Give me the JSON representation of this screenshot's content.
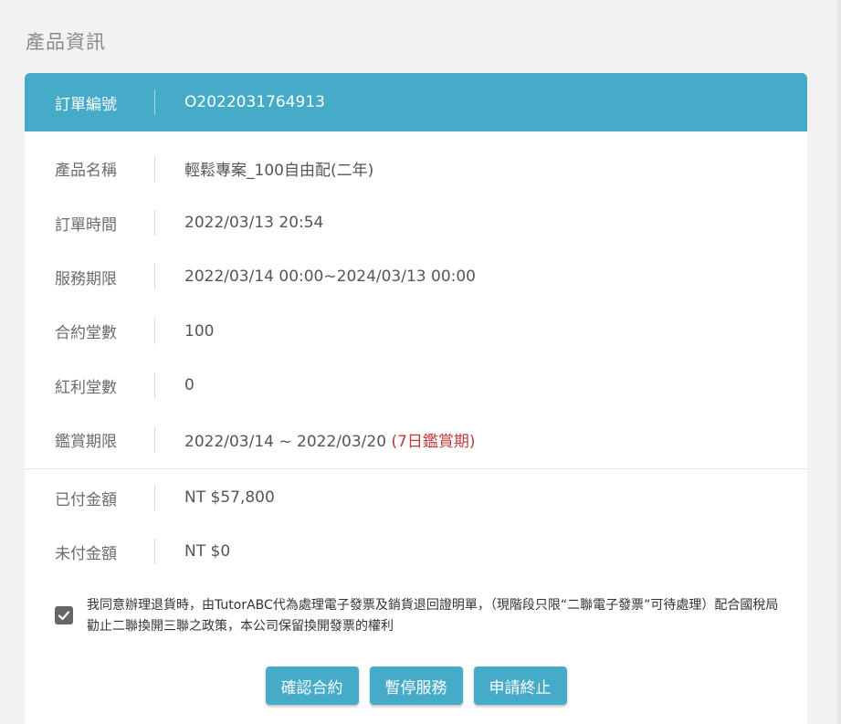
{
  "page": {
    "title": "產品資訊"
  },
  "order": {
    "label": "訂單編號",
    "number": "O2022031764913"
  },
  "details": [
    {
      "label": "產品名稱",
      "value": "輕鬆專案_100自由配(二年)"
    },
    {
      "label": "訂單時間",
      "value": "2022/03/13 20:54"
    },
    {
      "label": "服務期限",
      "value": "2022/03/14 00:00~2024/03/13 00:00"
    },
    {
      "label": "合約堂數",
      "value": "100"
    },
    {
      "label": "紅利堂數",
      "value": "0"
    },
    {
      "label": "鑑賞期限",
      "value": "2022/03/14 ~ 2022/03/20",
      "note": "(7日鑑賞期)"
    }
  ],
  "payment": [
    {
      "label": "已付金額",
      "value": "NT $57,800"
    },
    {
      "label": "未付金額",
      "value": "NT $0"
    }
  ],
  "agreement": {
    "checked": true,
    "text": "我同意辦理退貨時，由TutorABC代為處理電子發票及銷貨退回證明單，（現階段只限“二聯電子發票”可待處理）配合國稅局勸止二聯換開三聯之政策，本公司保留換開發票的權利"
  },
  "actions": {
    "confirm": "確認合約",
    "pause": "暫停服務",
    "terminate": "申請終止"
  },
  "colors": {
    "accent": "#45abc8",
    "note": "#c0393b"
  }
}
